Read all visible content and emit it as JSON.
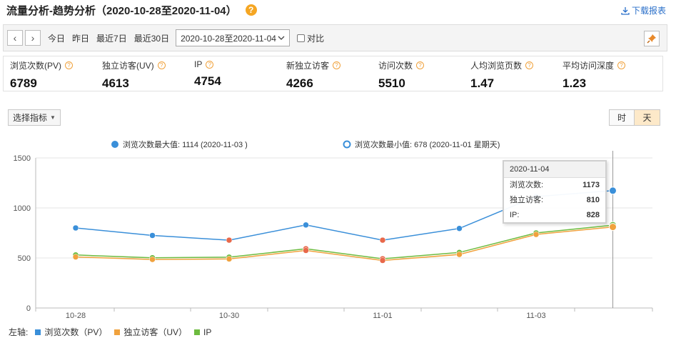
{
  "header": {
    "title": "流量分析-趋势分析（2020-10-28至2020-11-04）",
    "help": "?",
    "download_label": "下载报表"
  },
  "toolbar": {
    "quick_ranges": [
      "今日",
      "昨日",
      "最近7日",
      "最近30日"
    ],
    "date_range": "2020-10-28至2020-11-04",
    "compare_label": "对比"
  },
  "stats": [
    {
      "label": "浏览次数(PV)",
      "value": "6789"
    },
    {
      "label": "独立访客(UV)",
      "value": "4613"
    },
    {
      "label": "IP",
      "value": "4754"
    },
    {
      "label": "新独立访客",
      "value": "4266"
    },
    {
      "label": "访问次数",
      "value": "5510"
    },
    {
      "label": "人均浏览页数",
      "value": "1.47"
    },
    {
      "label": "平均访问深度",
      "value": "1.23"
    }
  ],
  "controls": {
    "select_metric": "选择指标",
    "hour": "时",
    "day": "天"
  },
  "chart_data": {
    "type": "line",
    "x": [
      "10-28",
      "10-29",
      "10-30",
      "10-31",
      "11-01",
      "11-02",
      "11-03",
      "11-04"
    ],
    "x_tick_labels": [
      "10-28",
      "10-30",
      "11-01",
      "11-03"
    ],
    "ylim": [
      0,
      1500
    ],
    "y_ticks": [
      0,
      500,
      1000,
      1500
    ],
    "grid": true,
    "legend_position": "bottom-left",
    "legend_prefix": "左轴:",
    "max_annotation": "浏览次数最大值: 1114 (2020-11-03 )",
    "min_annotation": "浏览次数最小值: 678 (2020-11-01 星期天)",
    "series": [
      {
        "name": "浏览次数（PV）",
        "color": "#3a8fd9",
        "values": [
          800,
          725,
          678,
          830,
          678,
          795,
          1114,
          1173
        ]
      },
      {
        "name": "独立访客（UV）",
        "color": "#f0a23e",
        "values": [
          510,
          485,
          490,
          575,
          475,
          535,
          735,
          810
        ]
      },
      {
        "name": "IP",
        "color": "#6dbb3f",
        "values": [
          530,
          502,
          508,
          592,
          492,
          555,
          750,
          828
        ]
      }
    ],
    "tooltip": {
      "title": "2020-11-04",
      "rows": [
        {
          "label": "浏览次数:",
          "value": "1173"
        },
        {
          "label": "独立访客:",
          "value": "810"
        },
        {
          "label": "IP:",
          "value": "828"
        }
      ]
    }
  }
}
